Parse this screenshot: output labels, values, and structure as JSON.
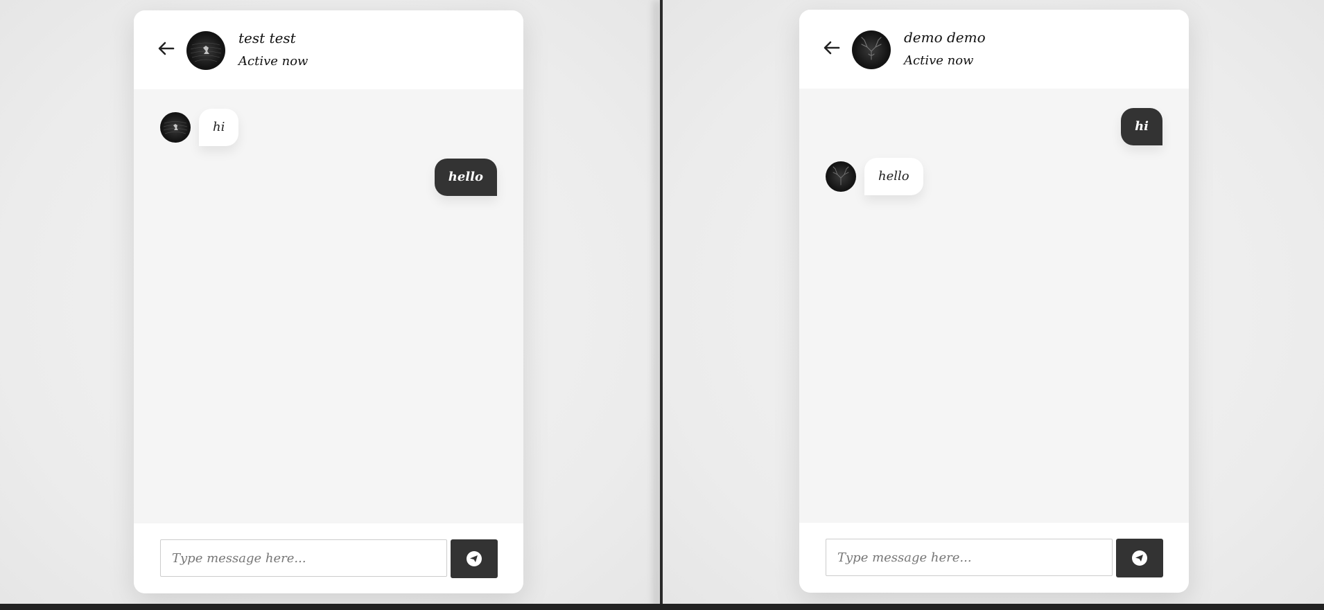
{
  "colors": {
    "bubble_outgoing": "#333333",
    "bubble_incoming": "#ffffff",
    "send_button": "#333333"
  },
  "left_chat": {
    "header": {
      "name": "test test",
      "status": "Active now"
    },
    "messages": [
      {
        "direction": "incoming",
        "text": "hi"
      },
      {
        "direction": "outgoing",
        "text": "hello"
      }
    ],
    "composer": {
      "placeholder": "Type message here..."
    }
  },
  "right_chat": {
    "header": {
      "name": "demo demo",
      "status": "Active now"
    },
    "messages": [
      {
        "direction": "outgoing",
        "text": "hi"
      },
      {
        "direction": "incoming",
        "text": "hello"
      }
    ],
    "composer": {
      "placeholder": "Type message here..."
    }
  }
}
